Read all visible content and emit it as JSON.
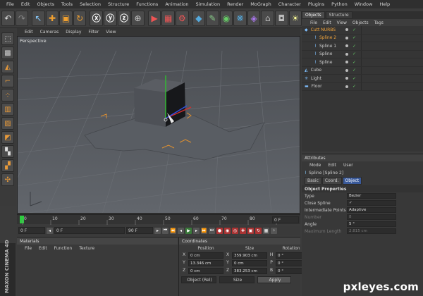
{
  "menubar": {
    "items": [
      "File",
      "Edit",
      "Objects",
      "Tools",
      "Selection",
      "Structure",
      "Functions",
      "Animation",
      "Simulation",
      "Render",
      "MoGraph",
      "Character",
      "Plugins",
      "Python",
      "Window",
      "Help"
    ]
  },
  "viewport": {
    "menu": [
      "Edit",
      "Cameras",
      "Display",
      "Filter",
      "View"
    ],
    "label": "Perspective"
  },
  "timeline": {
    "ticks": [
      "0",
      "10",
      "20",
      "30",
      "40",
      "50",
      "60",
      "70",
      "80",
      "90"
    ],
    "end_field": "0 F",
    "start_frame": "0 F",
    "current": "0 F",
    "end_frame": "90 F",
    "end2": "90 F"
  },
  "materials": {
    "title": "Materials",
    "menu": [
      "File",
      "Edit",
      "Function",
      "Texture"
    ]
  },
  "coordinates": {
    "title": "Coordinates",
    "headers": [
      "Position",
      "Size",
      "Rotation"
    ],
    "rows": [
      {
        "a": "X",
        "p": "0 cm",
        "b": "X",
        "s": "359.903 cm",
        "c": "H",
        "r": "0 °"
      },
      {
        "a": "Y",
        "p": "13.346 cm",
        "b": "Y",
        "s": "0 cm",
        "c": "P",
        "r": "0 °"
      },
      {
        "a": "Z",
        "p": "0 cm",
        "b": "Z",
        "s": "383.253 cm",
        "c": "B",
        "r": "0 °"
      }
    ],
    "mode": "Object (Rel)",
    "size_mode": "Size",
    "apply": "Apply"
  },
  "objects_panel": {
    "tabs": [
      "Objects",
      "Structure"
    ],
    "menu": [
      "File",
      "Edit",
      "View",
      "Objects",
      "Tags"
    ],
    "items": [
      {
        "name": "Cutt NURBS",
        "indent": 0,
        "highlight": true
      },
      {
        "name": "Spline 2",
        "indent": 1,
        "highlight": true
      },
      {
        "name": "Spline 1",
        "indent": 1,
        "highlight": false
      },
      {
        "name": "Spline",
        "indent": 1,
        "highlight": false
      },
      {
        "name": "Spline",
        "indent": 1,
        "highlight": false
      },
      {
        "name": "Cube",
        "indent": 0,
        "highlight": false
      },
      {
        "name": "Light",
        "indent": 0,
        "highlight": false
      },
      {
        "name": "Floor",
        "indent": 0,
        "highlight": false
      }
    ]
  },
  "attributes": {
    "title": "Attributes",
    "menu": [
      "Mode",
      "Edit",
      "User"
    ],
    "object_name": "Spline [Spline 2]",
    "tabs": [
      "Basic",
      "Coord.",
      "Object"
    ],
    "section": "Object Properties",
    "rows": [
      {
        "label": "Type",
        "value": "Bezier",
        "dim": false
      },
      {
        "label": "Close Spline",
        "value": "✓",
        "dim": false
      },
      {
        "label": "Intermediate Points",
        "value": "Adaptive",
        "dim": false
      },
      {
        "label": "Number",
        "value": "8",
        "dim": true
      },
      {
        "label": "Angle",
        "value": "5 °",
        "dim": false
      },
      {
        "label": "Maximum Length",
        "value": "2.815 cm",
        "dim": true
      }
    ]
  },
  "branding": {
    "maxon": "MAXON CINEMA 4D",
    "watermark": "pxleyes.com"
  }
}
